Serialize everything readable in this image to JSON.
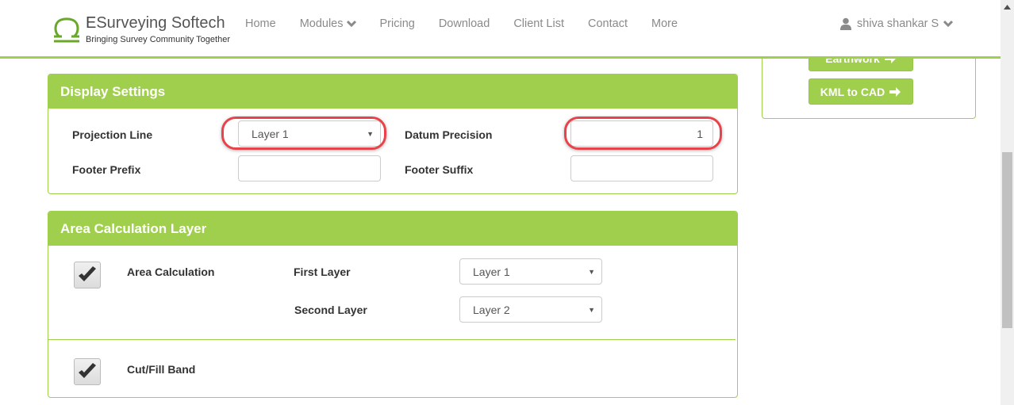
{
  "brand": {
    "title_prefix": "E",
    "title_rest": "Surveying Softech",
    "tagline": "Bringing Survey Community Together",
    "accent_color": "#a0cf4e"
  },
  "nav": {
    "items": [
      {
        "label": "Home",
        "has_dropdown": false
      },
      {
        "label": "Modules",
        "has_dropdown": true
      },
      {
        "label": "Pricing",
        "has_dropdown": false
      },
      {
        "label": "Download",
        "has_dropdown": false
      },
      {
        "label": "Client List",
        "has_dropdown": false
      },
      {
        "label": "Contact",
        "has_dropdown": false
      },
      {
        "label": "More",
        "has_dropdown": false
      }
    ],
    "user": {
      "name": "shiva shankar S",
      "icon": "user-icon"
    }
  },
  "sidebar": {
    "buttons": [
      {
        "label": "Earthwork",
        "icon": "arrow-right-icon"
      },
      {
        "label": "KML to CAD",
        "icon": "arrow-right-icon"
      }
    ]
  },
  "display_settings": {
    "title": "Display Settings",
    "projection_line": {
      "label": "Projection Line",
      "value": "Layer 1"
    },
    "datum_precision": {
      "label": "Datum Precision",
      "value": "1"
    },
    "footer_prefix": {
      "label": "Footer Prefix",
      "value": ""
    },
    "footer_suffix": {
      "label": "Footer Suffix",
      "value": ""
    }
  },
  "area_calculation": {
    "title": "Area Calculation Layer",
    "area_calc": {
      "label": "Area Calculation",
      "checked": true
    },
    "first_layer": {
      "label": "First Layer",
      "value": "Layer 1"
    },
    "second_layer": {
      "label": "Second Layer",
      "value": "Layer 2"
    },
    "cut_fill": {
      "label": "Cut/Fill Band",
      "checked": true
    }
  },
  "highlight_color": "#e8434a"
}
